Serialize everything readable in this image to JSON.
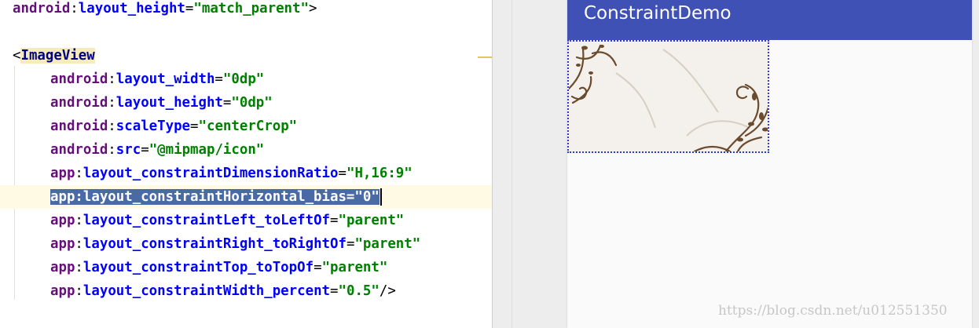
{
  "editor": {
    "lines": [
      {
        "ns": "android",
        "name": "layout_height",
        "value": "\"match_parent\"",
        "suffix": ">"
      },
      {
        "tag_open": "<",
        "tag": "ImageView"
      },
      {
        "ns": "android",
        "name": "layout_width",
        "value": "\"0dp\""
      },
      {
        "ns": "android",
        "name": "layout_height",
        "value": "\"0dp\""
      },
      {
        "ns": "android",
        "name": "scaleType",
        "value": "\"centerCrop\""
      },
      {
        "ns": "android",
        "name": "src",
        "value": "\"@mipmap/icon\""
      },
      {
        "ns": "app",
        "name": "layout_constraintDimensionRatio",
        "value": "\"H,16:9\""
      },
      {
        "selected_text": "app:layout_constraintHorizontal_bias=\"0\""
      },
      {
        "ns": "app",
        "name": "layout_constraintLeft_toLeftOf",
        "value": "\"parent\""
      },
      {
        "ns": "app",
        "name": "layout_constraintRight_toRightOf",
        "value": "\"parent\""
      },
      {
        "ns": "app",
        "name": "layout_constraintTop_toTopOf",
        "value": "\"parent\""
      },
      {
        "ns": "app",
        "name": "layout_constraintWidth_percent",
        "value": "\"0.5\"",
        "suffix": "/>"
      }
    ]
  },
  "preview": {
    "app_title": "ConstraintDemo",
    "appbar_color": "#3f51b5",
    "image_view": {
      "scale_type": "centerCrop",
      "width_percent": 0.5,
      "ratio": "16:9"
    }
  },
  "watermark": "https://blog.csdn.net/u012551350",
  "colors": {
    "namespace": "#660e7a",
    "attribute": "#0000ff",
    "value": "#008000",
    "selection": "#4a6aa5"
  }
}
